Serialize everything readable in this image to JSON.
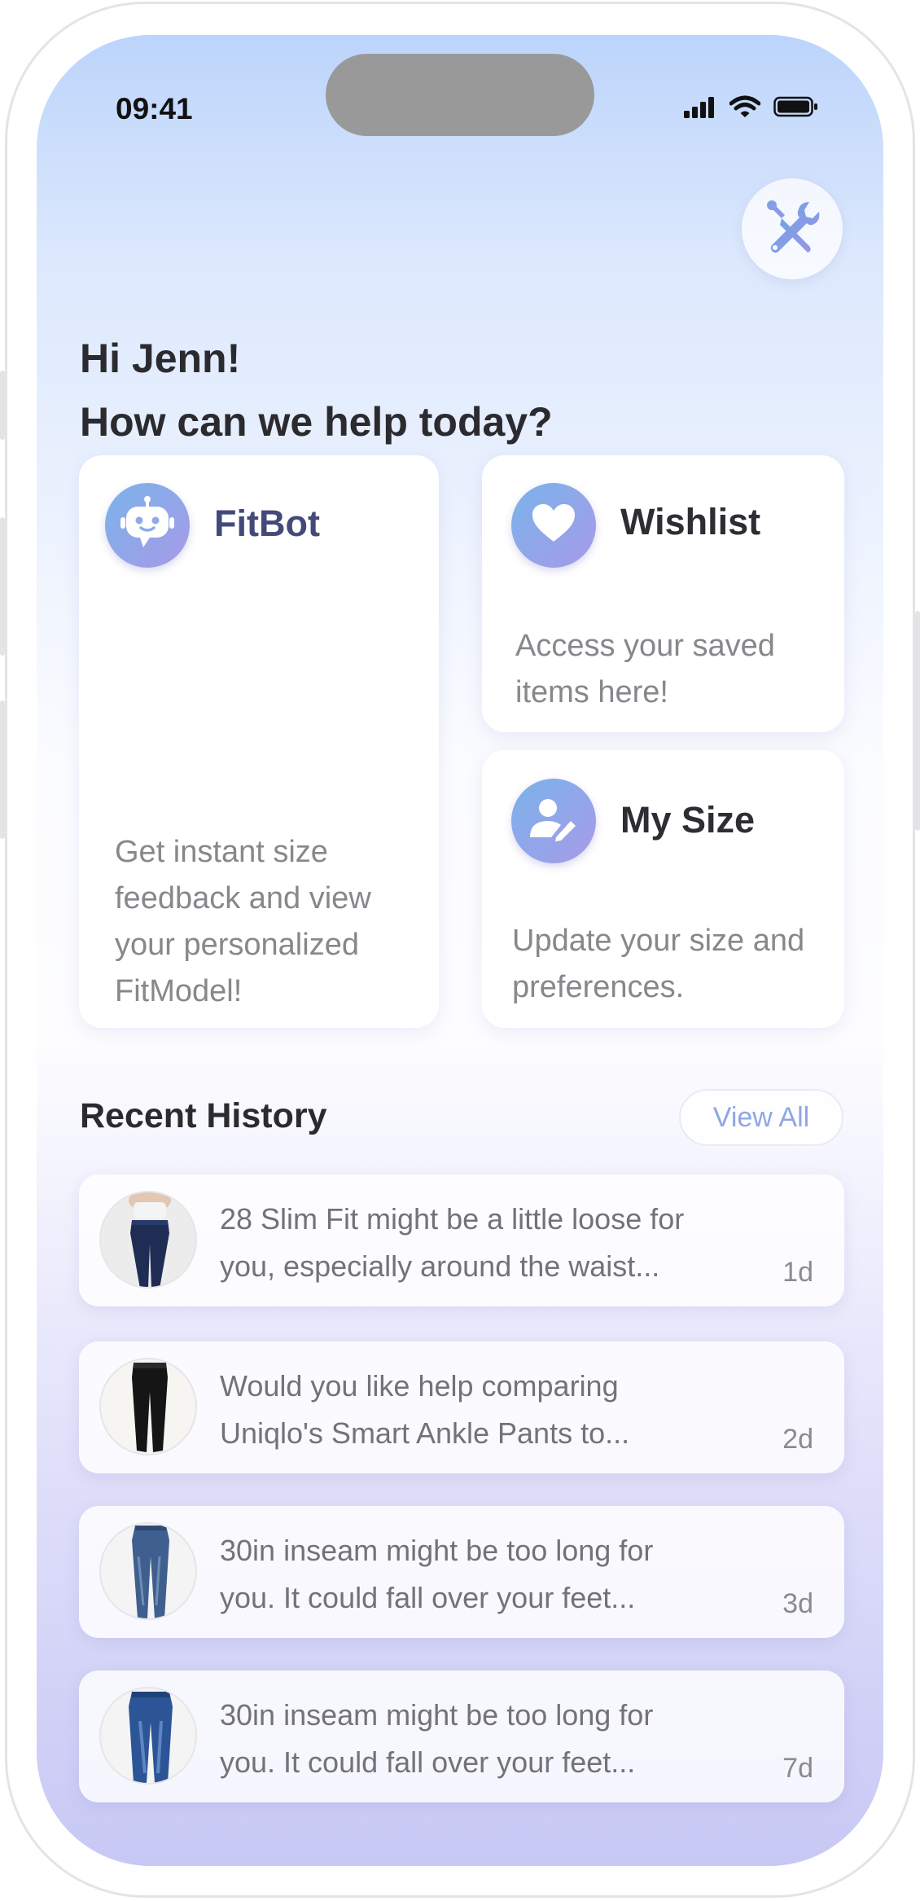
{
  "status_bar": {
    "time": "09:41"
  },
  "greeting": {
    "line1": "Hi Jenn!",
    "line2": "How can we help today?"
  },
  "cards": {
    "fitbot": {
      "title": "FitBot",
      "description": "Get instant size feedback and view your personalized FitModel!"
    },
    "wishlist": {
      "title": "Wishlist",
      "description": "Access your saved items here!"
    },
    "my_size": {
      "title": "My Size",
      "description": "Update your size and preferences."
    }
  },
  "recent_history": {
    "title": "Recent History",
    "view_all_label": "View All",
    "items": [
      {
        "text_line1": "28 Slim Fit might be a little loose for",
        "text_line2": "you, especially around the waist...",
        "age": "1d"
      },
      {
        "text_line1": "Would you like help comparing",
        "text_line2": "Uniqlo's Smart Ankle Pants to...",
        "age": "2d"
      },
      {
        "text_line1": "30in inseam might be too long for",
        "text_line2": "you. It could fall over your feet...",
        "age": "3d"
      },
      {
        "text_line1": "30in inseam might be too long for",
        "text_line2": "you. It could fall over your feet...",
        "age": "7d"
      }
    ]
  },
  "colors": {
    "accent": "#8fa6e4",
    "icon_gradient_start": "#7ab3ea",
    "icon_gradient_end": "#a79ae8",
    "heading_text": "#2b2b2f",
    "body_text": "#87878c"
  },
  "icons": [
    "cellular-signal-icon",
    "wifi-icon",
    "battery-icon",
    "tools-icon",
    "robot-icon",
    "heart-icon",
    "user-edit-icon"
  ]
}
